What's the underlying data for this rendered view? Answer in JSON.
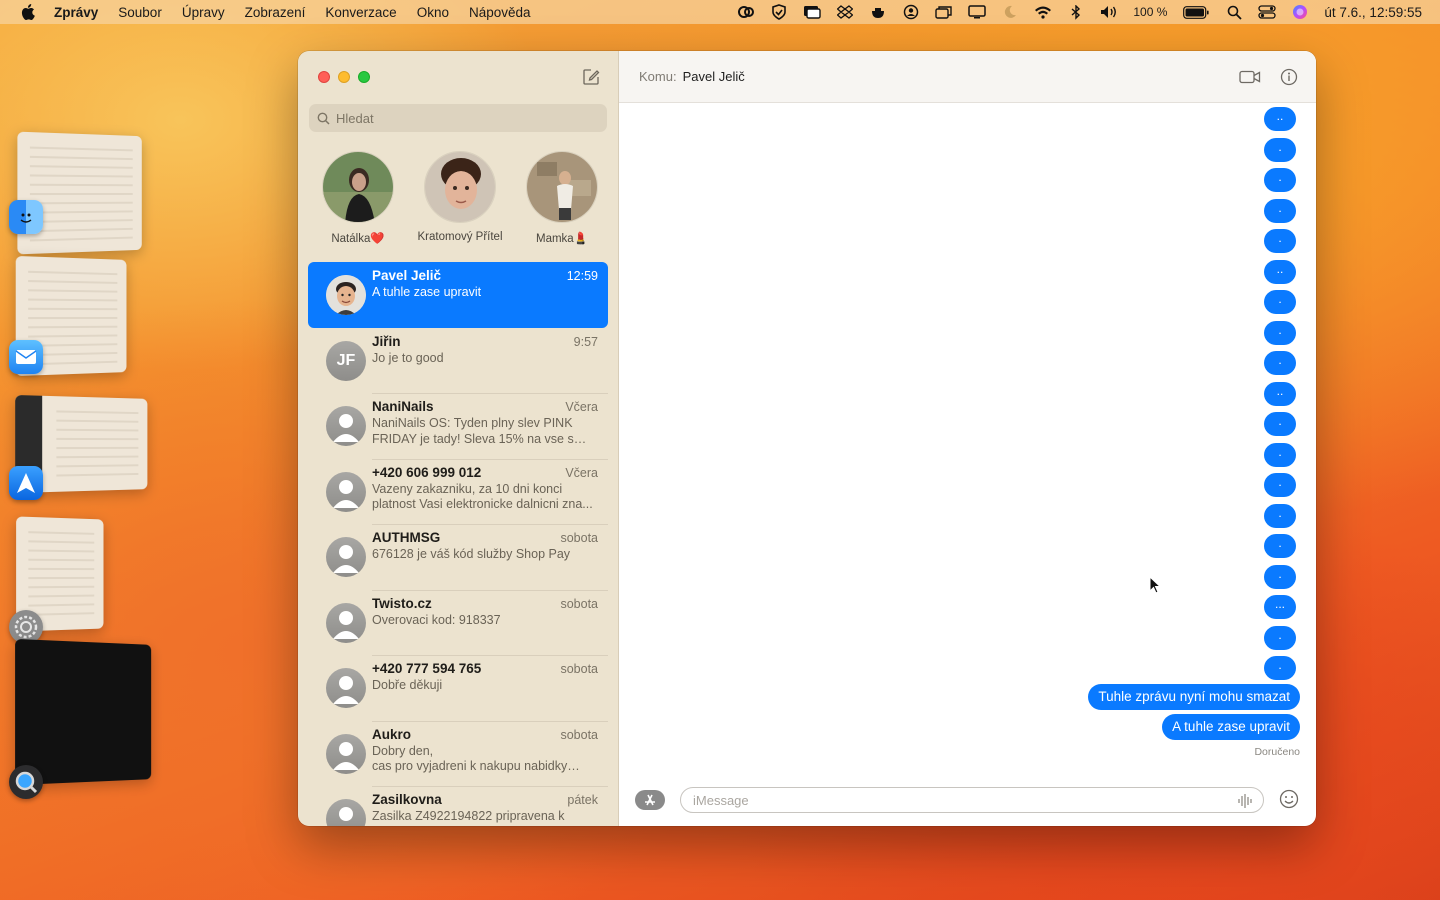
{
  "menubar": {
    "app_name": "Zprávy",
    "items": [
      "Soubor",
      "Úpravy",
      "Zobrazení",
      "Konverzace",
      "Okno",
      "Nápověda"
    ],
    "battery": "100 %",
    "clock": "út 7.6., 12:59:55"
  },
  "sidebar": {
    "search_placeholder": "Hledat",
    "pinned": [
      {
        "name": "Natálka❤️"
      },
      {
        "name": "Kratomový Přítel"
      },
      {
        "name": "Mamka💄"
      }
    ],
    "conversations": [
      {
        "name": "Pavel Jelič",
        "time": "12:59",
        "preview": "A tuhle zase upravit",
        "initials": ""
      },
      {
        "name": "Jiřin",
        "time": "9:57",
        "preview": "Jo je to good",
        "initials": "JF"
      },
      {
        "name": "NaniNails",
        "time": "Včera",
        "preview": "NaniNails OS: Tyden plny slev PINK FRIDAY je tady! Sleva 15% na vse s kod...",
        "initials": ""
      },
      {
        "name": "+420 606 999 012",
        "time": "Včera",
        "preview": "Vazeny zakazniku, za 10 dni konci platnost Vasi elektronicke dalnicni zna...",
        "initials": ""
      },
      {
        "name": "AUTHMSG",
        "time": "sobota",
        "preview": "676128 je váš kód služby Shop Pay",
        "initials": ""
      },
      {
        "name": "Twisto.cz",
        "time": "sobota",
        "preview": "Overovaci kod: 918337",
        "initials": ""
      },
      {
        "name": "+420 777 594 765",
        "time": "sobota",
        "preview": "Dobře děkuji",
        "initials": ""
      },
      {
        "name": "Aukro",
        "time": "sobota",
        "preview": "Dobry den,\ncas pro vyjadreni k nakupu nabidky 701...",
        "initials": ""
      },
      {
        "name": "Zasilkovna",
        "time": "pátek",
        "preview": "Zasilka Z4922194822 pripravena k",
        "initials": ""
      }
    ]
  },
  "chat": {
    "to_label": "Komu:",
    "recipient": "Pavel Jelič",
    "dot_messages": [
      "..",
      ".",
      ".",
      ".",
      ".",
      "..",
      ".",
      ".",
      ".",
      "..",
      ".",
      ".",
      ".",
      ".",
      ".",
      ".",
      "...",
      ".",
      "."
    ],
    "messages": [
      "Tuhle zprávu nyní mohu smazat",
      "A tuhle zase upravit"
    ],
    "status": "Doručeno",
    "input_placeholder": "iMessage"
  },
  "colors": {
    "accent": "#0a7aff",
    "sidebar_bg": "#ece3cf"
  }
}
